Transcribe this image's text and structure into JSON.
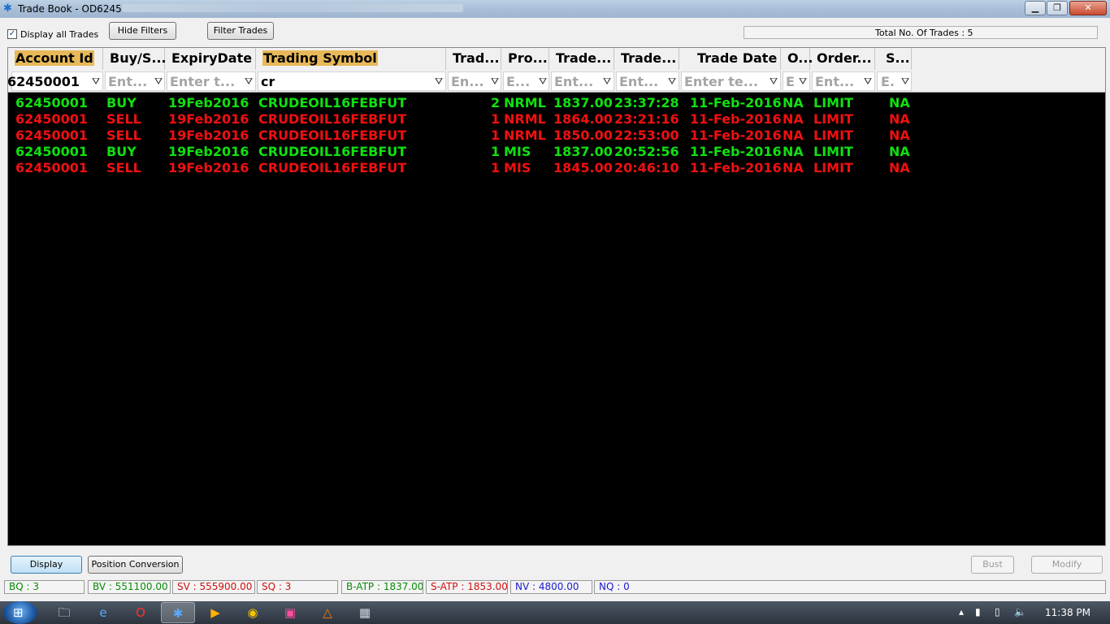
{
  "window": {
    "title": "Trade Book - OD6245"
  },
  "toolbar": {
    "display_all_label": "Display all Trades",
    "display_all_checked": "✓",
    "hide_filters_label": "Hide Filters",
    "filter_trades_label": "Filter Trades",
    "total_trades": "Total No. Of Trades : 5"
  },
  "grid": {
    "headers": [
      "Account Id",
      "Buy/S...",
      "ExpiryDate",
      "Trading Symbol",
      "Trad...",
      "Pro...",
      "Trade...",
      "Trade...",
      "Trade Date",
      "O...",
      "Order...",
      "S..."
    ],
    "filters": [
      "62450001",
      "Ent...",
      "Enter t...",
      "cr",
      "En...",
      "E...",
      "Ent...",
      "Ent...",
      "Enter te...",
      "E",
      "Ent...",
      "E."
    ],
    "rows": [
      {
        "side": "buy",
        "account": "62450001",
        "buysell": "BUY",
        "expiry": "19Feb2016",
        "symbol": "CRUDEOIL16FEBFUT",
        "qty": "2",
        "product": "NRML",
        "price": "1837.00",
        "time": "23:37:28",
        "date": "11-Feb-2016",
        "o": "NA",
        "order": "LIMIT",
        "s": "NA"
      },
      {
        "side": "sell",
        "account": "62450001",
        "buysell": "SELL",
        "expiry": "19Feb2016",
        "symbol": "CRUDEOIL16FEBFUT",
        "qty": "1",
        "product": "NRML",
        "price": "1864.00",
        "time": "23:21:16",
        "date": "11-Feb-2016",
        "o": "NA",
        "order": "LIMIT",
        "s": "NA"
      },
      {
        "side": "sell",
        "account": "62450001",
        "buysell": "SELL",
        "expiry": "19Feb2016",
        "symbol": "CRUDEOIL16FEBFUT",
        "qty": "1",
        "product": "NRML",
        "price": "1850.00",
        "time": "22:53:00",
        "date": "11-Feb-2016",
        "o": "NA",
        "order": "LIMIT",
        "s": "NA"
      },
      {
        "side": "buy",
        "account": "62450001",
        "buysell": "BUY",
        "expiry": "19Feb2016",
        "symbol": "CRUDEOIL16FEBFUT",
        "qty": "1",
        "product": "MIS",
        "price": "1837.00",
        "time": "20:52:56",
        "date": "11-Feb-2016",
        "o": "NA",
        "order": "LIMIT",
        "s": "NA"
      },
      {
        "side": "sell",
        "account": "62450001",
        "buysell": "SELL",
        "expiry": "19Feb2016",
        "symbol": "CRUDEOIL16FEBFUT",
        "qty": "1",
        "product": "MIS",
        "price": "1845.00",
        "time": "20:46:10",
        "date": "11-Feb-2016",
        "o": "NA",
        "order": "LIMIT",
        "s": "NA"
      }
    ]
  },
  "bottom": {
    "display_label": "Display",
    "position_conversion_label": "Position Conversion",
    "bust_label": "Bust",
    "modify_label": "Modify"
  },
  "status": {
    "bq": "BQ : 3",
    "bv": "BV : 551100.00",
    "sv": "SV : 555900.00",
    "sq": "SQ : 3",
    "batp": "B-ATP : 1837.00",
    "satp": "S-ATP : 1853.00",
    "nv": "NV : 4800.00",
    "nq": "NQ : 0"
  },
  "colors": {
    "buy": "#10e010",
    "sell": "#f01010",
    "header_highlight": "#e7b959",
    "net": "#1a1ad0"
  },
  "taskbar": {
    "clock": "11:38 PM"
  }
}
